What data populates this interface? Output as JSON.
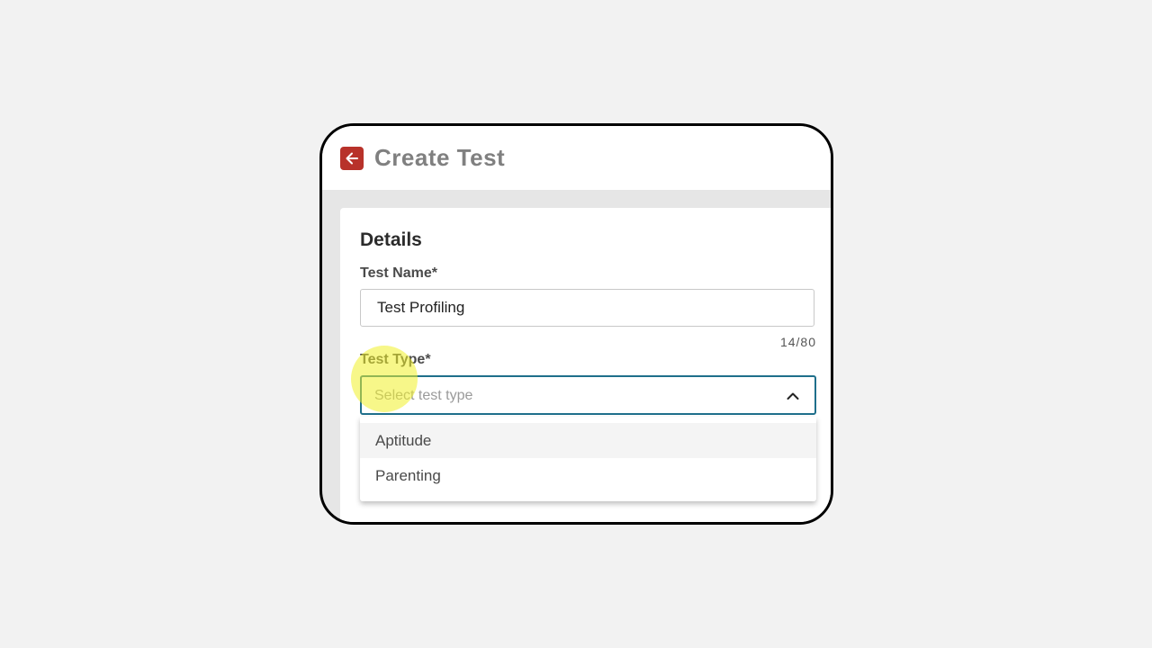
{
  "header": {
    "title": "Create Test",
    "back_icon": "arrow-left-icon",
    "back_color": "#b8322a"
  },
  "details": {
    "title": "Details",
    "test_name": {
      "label": "Test Name*",
      "value": "Test Profiling",
      "counter": "14/80"
    },
    "test_type": {
      "label": "Test Type*",
      "placeholder": "Select test type",
      "chevron_icon": "chevron-up-icon",
      "accent": "#1f6f8b",
      "options": [
        {
          "label": "Aptitude"
        },
        {
          "label": "Parenting"
        }
      ]
    }
  }
}
